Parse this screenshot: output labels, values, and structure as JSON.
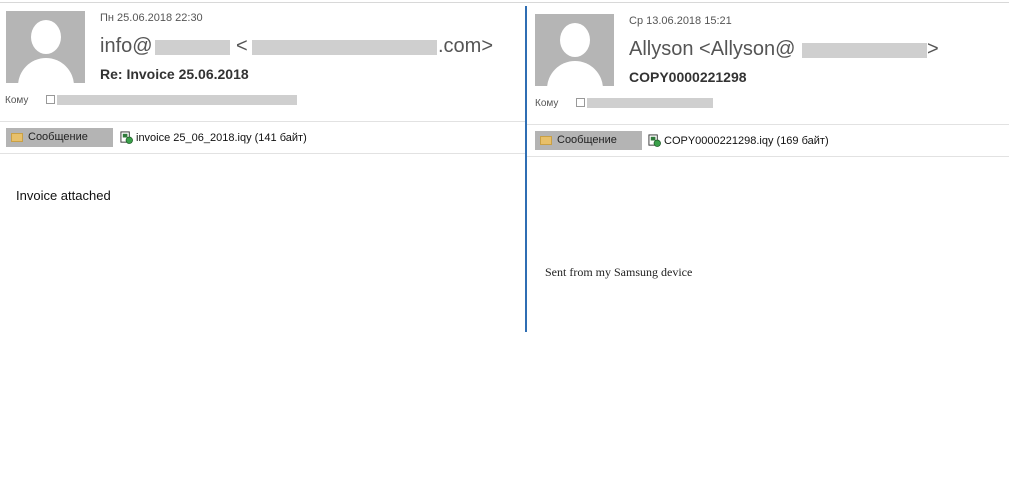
{
  "left": {
    "date": "Пн 25.06.2018 22:30",
    "sender_prefix": "info@",
    "sender_mid": "<",
    "sender_suffix": ".com>",
    "subject": "Re: Invoice 25.06.2018",
    "to_label": "Кому",
    "tab_label": "Сообщение",
    "attachment": "invoice 25_06_2018.iqy (141 байт)",
    "body": "Invoice attached"
  },
  "right": {
    "date": "Ср 13.06.2018 15:21",
    "sender_prefix": "Allyson <Allyson@",
    "sender_suffix": ">",
    "subject": "COPY0000221298",
    "to_label": "Кому",
    "tab_label": "Сообщение",
    "attachment": "COPY0000221298.iqy (169 байт)",
    "body": "Sent from my Samsung device"
  },
  "colors": {
    "divider": "#2f6eb3",
    "tab_bg": "#b4b4b4",
    "redaction": "#cfcfcf"
  }
}
